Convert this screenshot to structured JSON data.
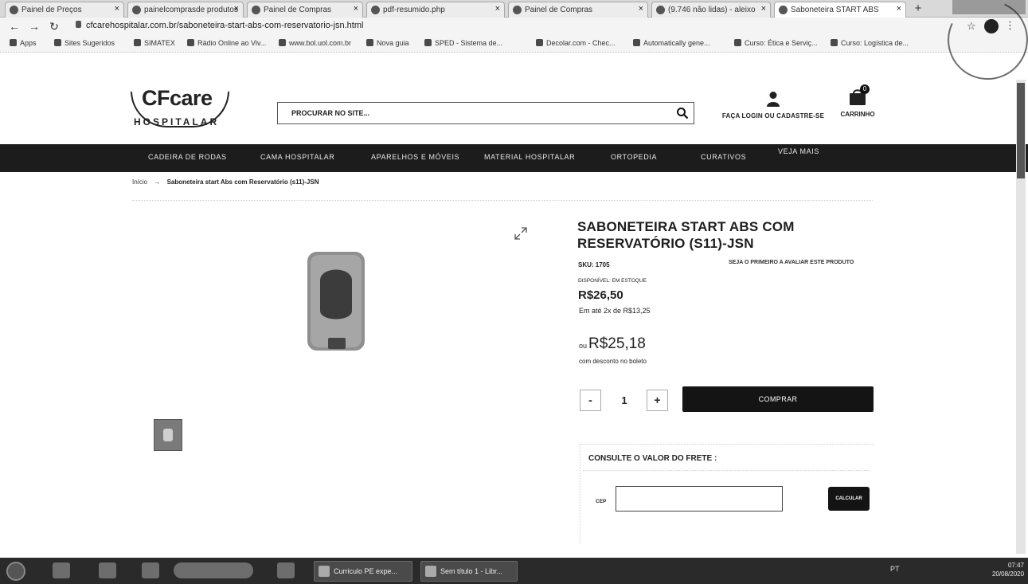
{
  "browser": {
    "tabs": [
      {
        "label": "Painel de Preços",
        "active": false
      },
      {
        "label": "painelcomprasde produtos",
        "active": false
      },
      {
        "label": "Painel de Compras",
        "active": false
      },
      {
        "label": "pdf-resumido.php",
        "active": false
      },
      {
        "label": "Painel de Compras",
        "active": false
      },
      {
        "label": "(9.746 não lidas) - aleixo",
        "active": false
      },
      {
        "label": "Saboneteira START ABS",
        "active": true
      }
    ],
    "url": "cfcarehospitalar.com.br/saboneteira-start-abs-com-reservatorio-jsn.html",
    "bookmarks": [
      "Apps",
      "Sites Sugeridos",
      "SIMATEX",
      "Rádio Online ao Viv...",
      "www.bol.uol.com.br",
      "Nova guia",
      "SPED - Sistema de...",
      "Decolar.com - Chec...",
      "Automatically gene...",
      "Curso: Ética e Serviç...",
      "Curso: Logística de..."
    ]
  },
  "header": {
    "logo_main": "CFcare",
    "logo_sub": "HOSPITALAR",
    "search_placeholder": "PROCURAR NO SITE...",
    "account_label": "FAÇA LOGIN OU CADASTRE-SE",
    "cart_label": "CARRINHO",
    "cart_count": "0"
  },
  "nav": [
    "CADEIRA DE RODAS",
    "CAMA HOSPITALAR",
    "APARELHOS E MÓVEIS",
    "MATERIAL HOSPITALAR",
    "ORTOPEDIA",
    "CURATIVOS",
    "VEJA MAIS"
  ],
  "breadcrumb": {
    "home": "Início",
    "separator": "→",
    "current": "Saboneteira start Abs com Reservatório (s11)-JSN"
  },
  "product": {
    "title": "SABONETEIRA START ABS COM RESERVATÓRIO (S11)-JSN",
    "sku": "SKU: 1705",
    "first_review": "SEJA O PRIMEIRO A AVALIAR ESTE PRODUTO",
    "availability": "DISPONÍVEL: EM ESTOQUE",
    "price": "R$26,50",
    "installments": "Em até 2x de R$13,25",
    "discount_prefix": "ou",
    "discount_price": "R$25,18",
    "discount_note": "com desconto no boleto",
    "qty_minus": "-",
    "qty_value": "1",
    "qty_plus": "+",
    "buy_label": "COMPRAR"
  },
  "freight": {
    "title": "CONSULTE O VALOR DO FRETE :",
    "cep_label": "CEP",
    "calc_label": "CALCULAR"
  },
  "taskbar": {
    "tasks": [
      "Curriculo PE expe...",
      "Sem título 1 - Libr..."
    ],
    "tray": "PT",
    "time": "07:47",
    "date": "20/08/2020"
  },
  "colors": {
    "nav_bg": "#1c1c1c",
    "button_bg": "#141414",
    "text": "#222222"
  }
}
